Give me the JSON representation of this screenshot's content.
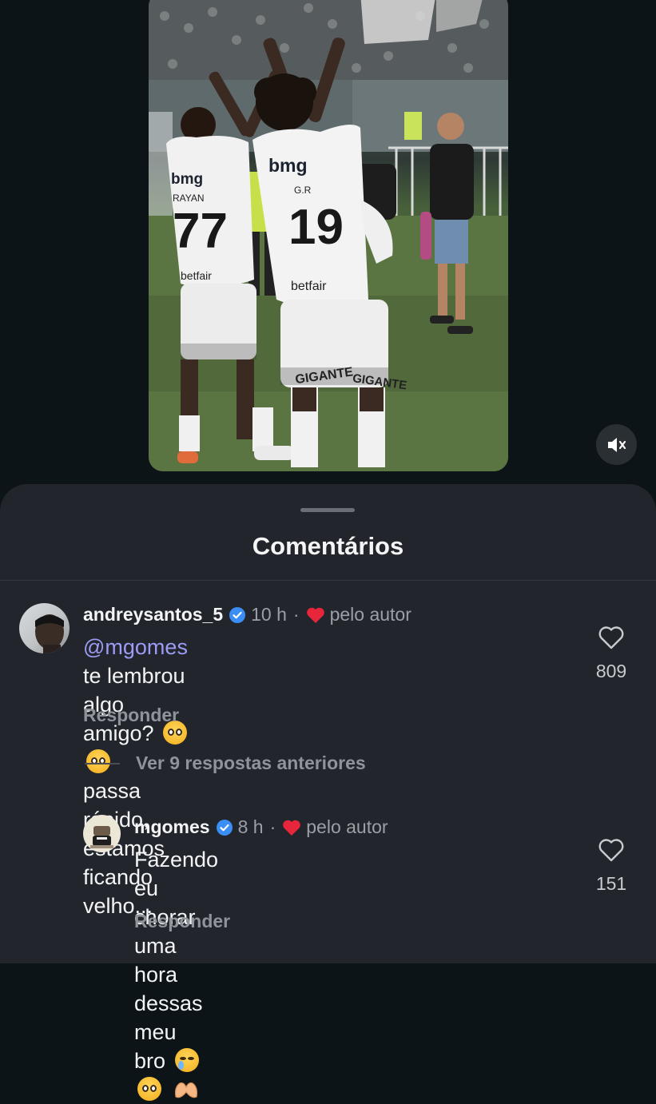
{
  "sheet": {
    "title": "Comentários"
  },
  "comments": [
    {
      "username": "andreysantos_5",
      "verified": true,
      "time": "10 h",
      "separator": "·",
      "author_like_label": "pelo autor",
      "mention": "@mgomes",
      "text_line1": " te lembrou algo amigo?",
      "text_line2": "passa rápido, estamos ficando velho...",
      "emojis": [
        "pleading-face",
        "pleading-face"
      ],
      "likes": "809",
      "reply_label": "Responder"
    },
    {
      "username": "mgomes",
      "verified": true,
      "time": "8 h",
      "separator": "·",
      "author_like_label": "pelo autor",
      "text_line1": "Fazendo eu chorar uma hora dessas meu",
      "text_line2": "bro",
      "emojis": [
        "crying-face",
        "pleading-face",
        "heart-hands"
      ],
      "likes": "151",
      "reply_label": "Responder"
    }
  ],
  "view_replies_label": "Ver 9 respostas anteriores",
  "video": {
    "jersey_left": {
      "sponsor": "bmg",
      "name": "RAYAN",
      "number": "77",
      "bottom_sponsor": "betfair"
    },
    "jersey_right": {
      "sponsor": "bmg",
      "name": "G.R",
      "number": "19",
      "bottom_sponsor": "betfair"
    },
    "shorts_text": "GIGANTE"
  },
  "colors": {
    "background": "#0d1418",
    "sheet": "#22252b",
    "mention": "#9c9bf6",
    "verified": "#3a8ef6",
    "heart": "#e8263b",
    "muted_text": "#9aa0a6"
  },
  "icons": [
    "speaker-muted-icon",
    "verified-badge-icon",
    "heart-filled-icon",
    "heart-outline-icon"
  ]
}
